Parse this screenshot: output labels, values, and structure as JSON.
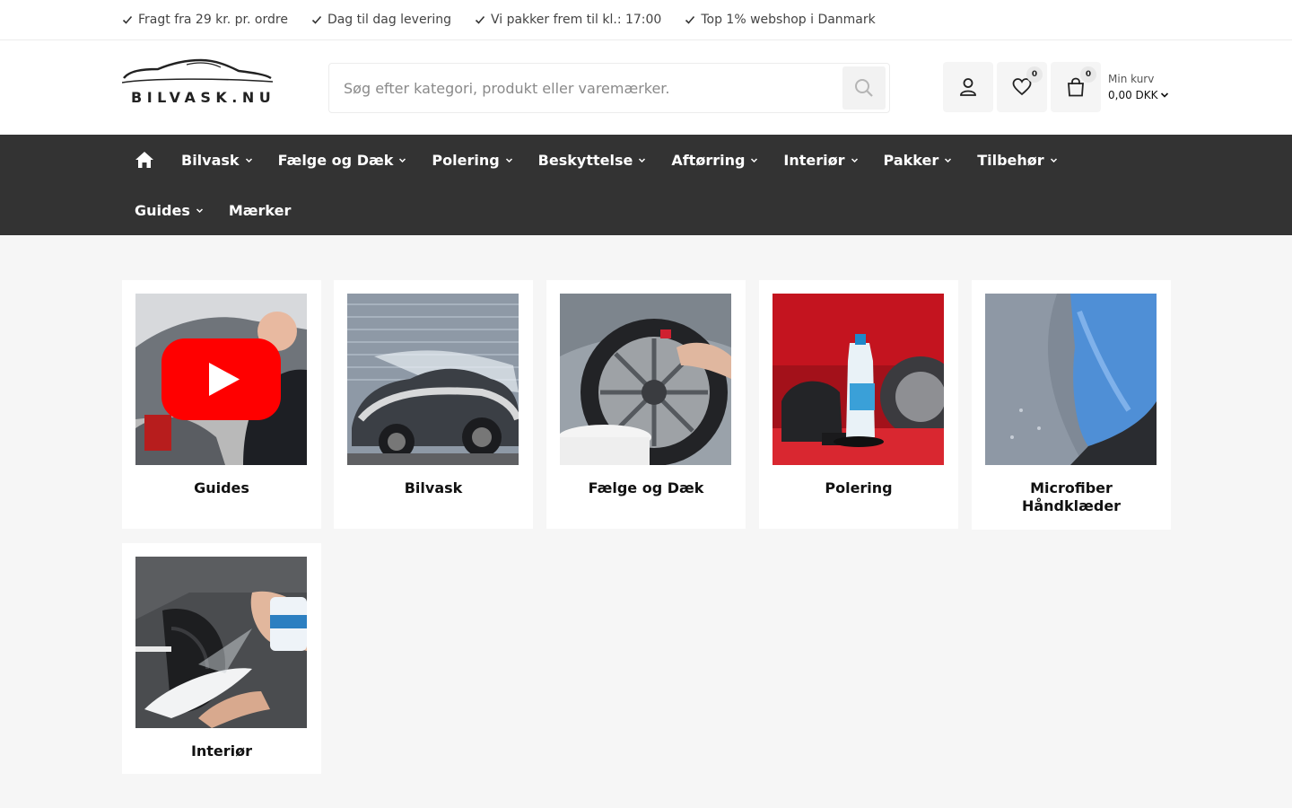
{
  "usps": [
    "Fragt fra 29 kr. pr. ordre",
    "Dag til dag levering",
    "Vi pakker frem til kl.: 17:00",
    "Top 1% webshop i Danmark"
  ],
  "logo": {
    "text": "BILVASK.NU"
  },
  "search": {
    "placeholder": "Søg efter kategori, produkt eller varemærker."
  },
  "header": {
    "wishlist_count": "0",
    "cart_count": "0",
    "cart_label": "Min kurv",
    "cart_total": "0,00 DKK"
  },
  "nav": {
    "row1": [
      "Bilvask",
      "Fælge og Dæk",
      "Polering",
      "Beskyttelse",
      "Aftørring",
      "Interiør",
      "Pakker",
      "Tilbehør"
    ],
    "row2": [
      "Guides",
      "Mærker"
    ]
  },
  "categories": [
    "Guides",
    "Bilvask",
    "Fælge og Dæk",
    "Polering",
    "Microfiber Håndklæder",
    "Interiør"
  ],
  "colors": {
    "nav_bg": "#333333",
    "page_bg": "#f6f6f6",
    "youtube_red": "#ff0000"
  }
}
